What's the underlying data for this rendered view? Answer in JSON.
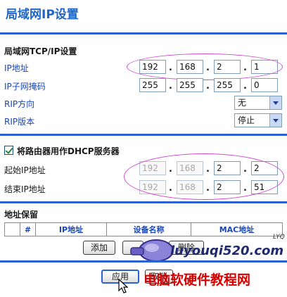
{
  "header": {
    "title": "局域网IP设置"
  },
  "lan": {
    "section_title": "局域网TCP/IP设置",
    "ip_label": "IP地址",
    "ip": [
      "192",
      "168",
      "2",
      "1"
    ],
    "subnet_label": "IP子网掩码",
    "subnet": [
      "255",
      "255",
      "255",
      "0"
    ],
    "rip_direction_label": "RIP方向",
    "rip_direction_value": "无",
    "rip_version_label": "RIP版本",
    "rip_version_value": "停止"
  },
  "dhcp": {
    "checkbox_label": "将路由器用作DHCP服务器",
    "checked": true,
    "start_label": "起始IP地址",
    "start": [
      "192",
      "168",
      "2",
      "2"
    ],
    "end_label": "结束IP地址",
    "end": [
      "192",
      "168",
      "2",
      "51"
    ]
  },
  "reservation": {
    "section_title": "地址保留",
    "columns": [
      "#",
      "IP地址",
      "设备名称",
      "MAC地址"
    ],
    "add_label": "添加",
    "delete_label": "删除"
  },
  "footer": {
    "apply_label": "应用",
    "cancel_label": "取消"
  },
  "watermark": {
    "url": "luyouqi520.com",
    "tag": "LYQ",
    "site": "电脑软硬件教程网"
  },
  "colors": {
    "accent": "#2a62d1",
    "annotation": "#d24bd2",
    "watermark": "#d40000"
  }
}
